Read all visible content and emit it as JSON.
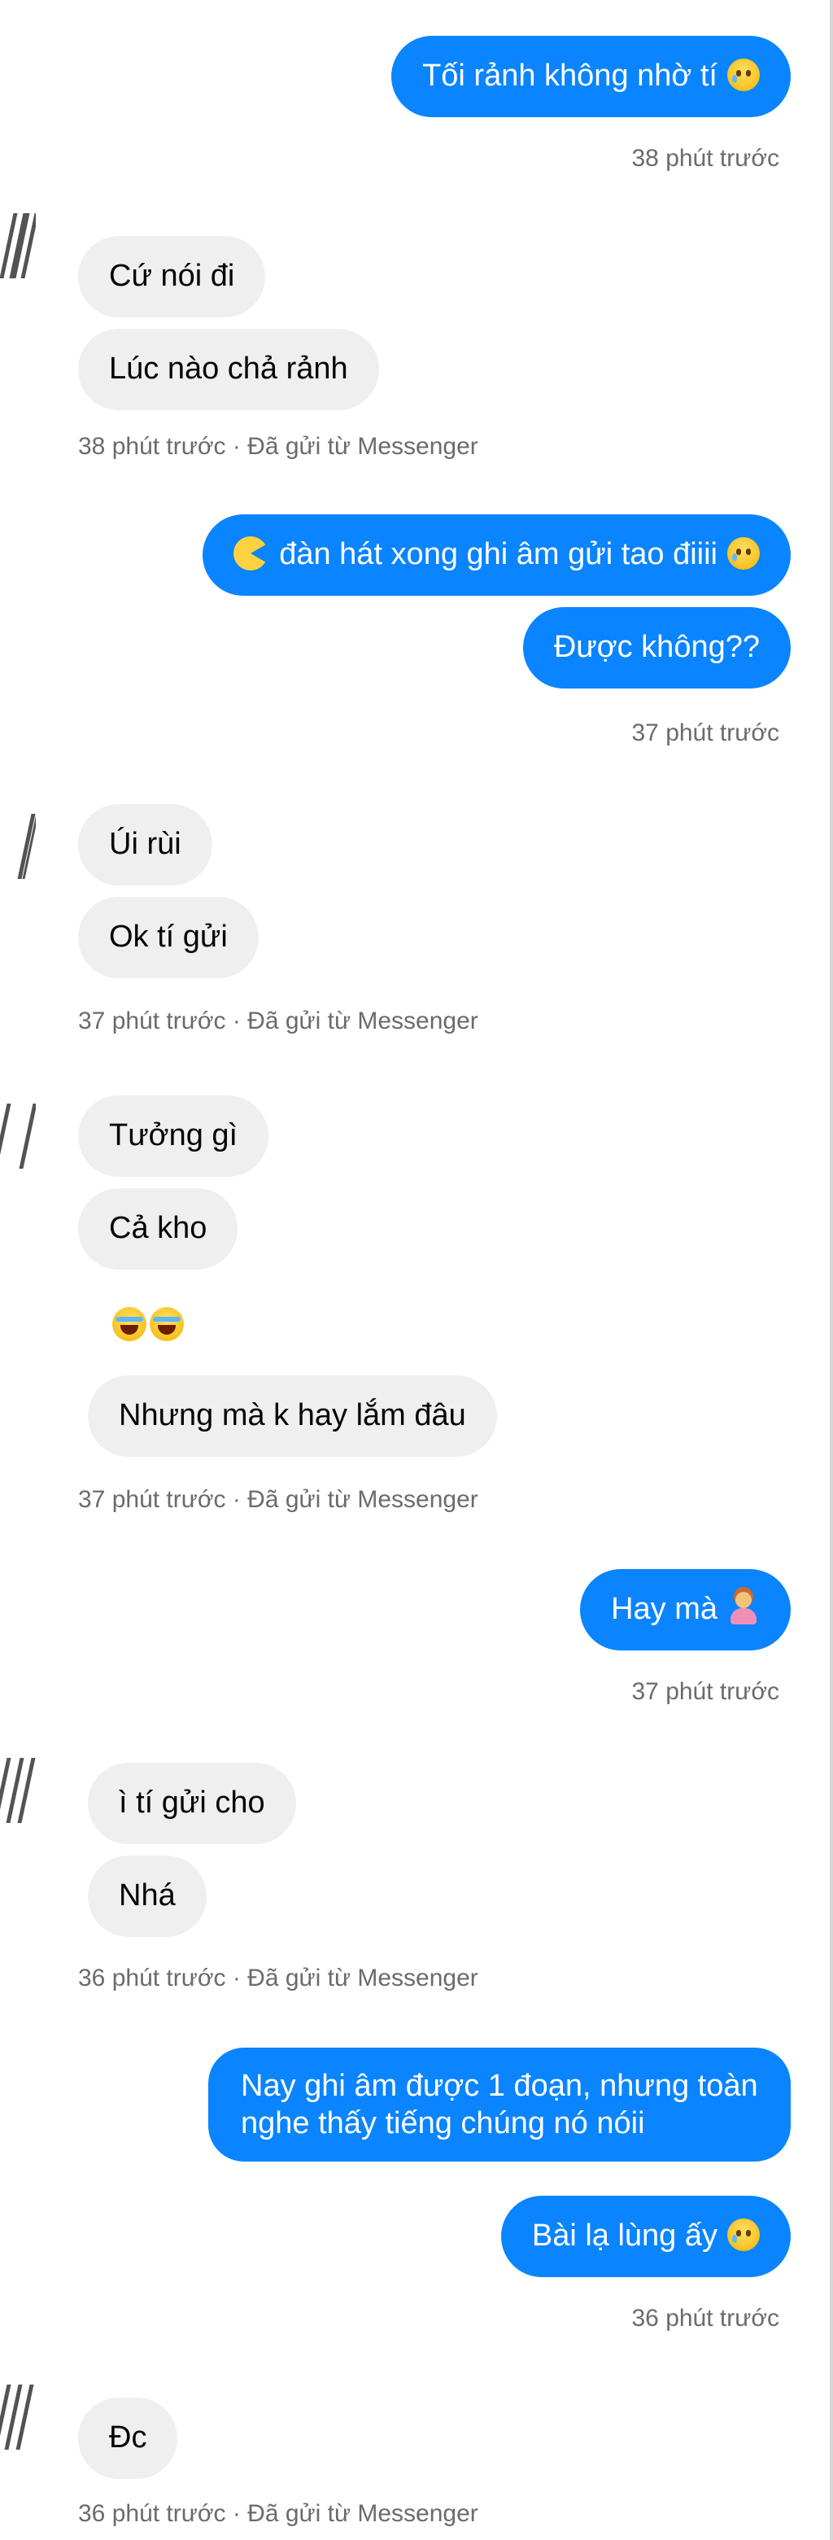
{
  "messages": [
    {
      "text": "Tối rảnh không nhờ tí"
    },
    {
      "text": "38 phút trước"
    },
    {
      "text": "Cứ nói đi"
    },
    {
      "text": "Lúc nào chả rảnh"
    },
    {
      "text": "38 phút trước · Đã gửi từ Messenger"
    },
    {
      "text": "đàn hát xong ghi âm gửi tao điiii"
    },
    {
      "text": "Được không??"
    },
    {
      "text": "37 phút trước"
    },
    {
      "text": "Úi rùi"
    },
    {
      "text": "Ok tí gửi"
    },
    {
      "text": "37 phút trước · Đã gửi từ Messenger"
    },
    {
      "text": "Tưởng gì"
    },
    {
      "text": "Cả kho"
    },
    {
      "text": "Nhưng mà k hay lắm đâu"
    },
    {
      "text": "37 phút trước · Đã gửi từ Messenger"
    },
    {
      "text": "Hay mà"
    },
    {
      "text": "37 phút trước"
    },
    {
      "text": "ì tí gửi cho"
    },
    {
      "text": "Nhá"
    },
    {
      "text": "36 phút trước · Đã gửi từ Messenger"
    },
    {
      "text": "Nay ghi âm được 1 đoạn, nhưng toàn nghe thấy tiếng chúng nó nóii"
    },
    {
      "text": "Bài lạ lùng ấy"
    },
    {
      "text": "36 phút trước"
    },
    {
      "text": "Đc"
    },
    {
      "text": "36 phút trước · Đã gửi từ Messenger"
    }
  ],
  "colors": {
    "outgoing_bubble": "#0a84ff",
    "incoming_bubble": "#efefef",
    "meta_text": "#6b6b6b"
  },
  "icons": [
    "crying-face-icon",
    "pacman-emoji-icon",
    "laughing-tears-emoji-icon",
    "woman-gesturing-emoji-icon"
  ]
}
